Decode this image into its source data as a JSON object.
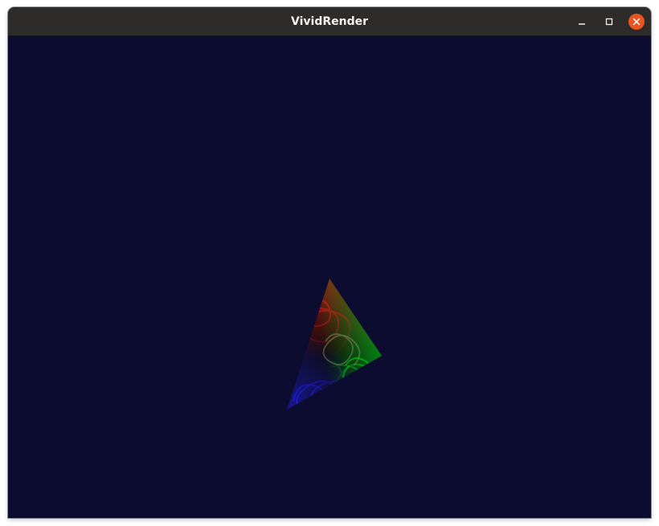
{
  "window": {
    "title": "VividRender",
    "controls": {
      "minimize_icon": "minimize-icon",
      "maximize_icon": "maximize-icon",
      "close_icon": "close-icon"
    }
  },
  "colors": {
    "titlebar_bg": "#2d2c2b",
    "title_text": "#f2f2f2",
    "close_accent": "#e95420",
    "viewport_bg": "#0c0c30",
    "vertex_top": "#ff1a1a",
    "vertex_right": "#00e61a",
    "vertex_bottom": "#1a1aff"
  }
}
